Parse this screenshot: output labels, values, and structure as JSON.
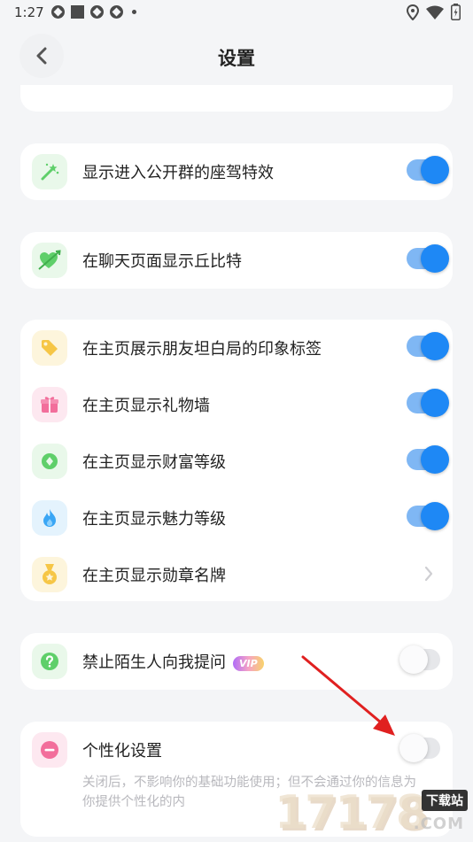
{
  "status_bar": {
    "time": "1:27"
  },
  "header": {
    "title": "设置"
  },
  "groups": [
    {
      "items": [
        {
          "label": "显示进入公开群的座驾特效",
          "icon": "magic-wand-icon",
          "icon_color": "#5fcf6a",
          "icon_bg": "#e9f8ea",
          "control": "toggle",
          "on": true
        }
      ]
    },
    {
      "items": [
        {
          "label": "在聊天页面显示丘比特",
          "icon": "cupid-heart-icon",
          "icon_color": "#5fcf6a",
          "icon_bg": "#e9f8ea",
          "control": "toggle",
          "on": true
        }
      ]
    },
    {
      "items": [
        {
          "label": "在主页展示朋友坦白局的印象标签",
          "icon": "tag-icon",
          "icon_color": "#f6c646",
          "icon_bg": "#fdf5dc",
          "control": "toggle",
          "on": true
        },
        {
          "label": "在主页显示礼物墙",
          "icon": "gift-icon",
          "icon_color": "#f26e9b",
          "icon_bg": "#fde8f0",
          "control": "toggle",
          "on": true
        },
        {
          "label": "在主页显示财富等级",
          "icon": "wealth-coin-icon",
          "icon_color": "#5fcf6a",
          "icon_bg": "#e9f8ea",
          "control": "toggle",
          "on": true
        },
        {
          "label": "在主页显示魅力等级",
          "icon": "flame-icon",
          "icon_color": "#3aa6f5",
          "icon_bg": "#e4f3fd",
          "control": "toggle",
          "on": true
        },
        {
          "label": "在主页显示勋章名牌",
          "icon": "medal-icon",
          "icon_color": "#f6c646",
          "icon_bg": "#fdf5dc",
          "control": "chevron"
        }
      ]
    },
    {
      "items": [
        {
          "label": "禁止陌生人向我提问",
          "badge": "VIP",
          "icon": "question-icon",
          "icon_color": "#5fcf6a",
          "icon_bg": "#e9f8ea",
          "control": "toggle",
          "on": false
        }
      ]
    },
    {
      "items": [
        {
          "label": "个性化设置",
          "icon": "minus-circle-icon",
          "icon_color": "#f26e9b",
          "icon_bg": "#fde8f0",
          "control": "toggle",
          "on": false,
          "description": "关闭后，不影响你的基础功能使用；但不会通过你的信息为你提供个性化的内"
        }
      ]
    }
  ],
  "watermark": {
    "digits": "17178",
    "badge": "下载站",
    "domain": ".COM"
  }
}
